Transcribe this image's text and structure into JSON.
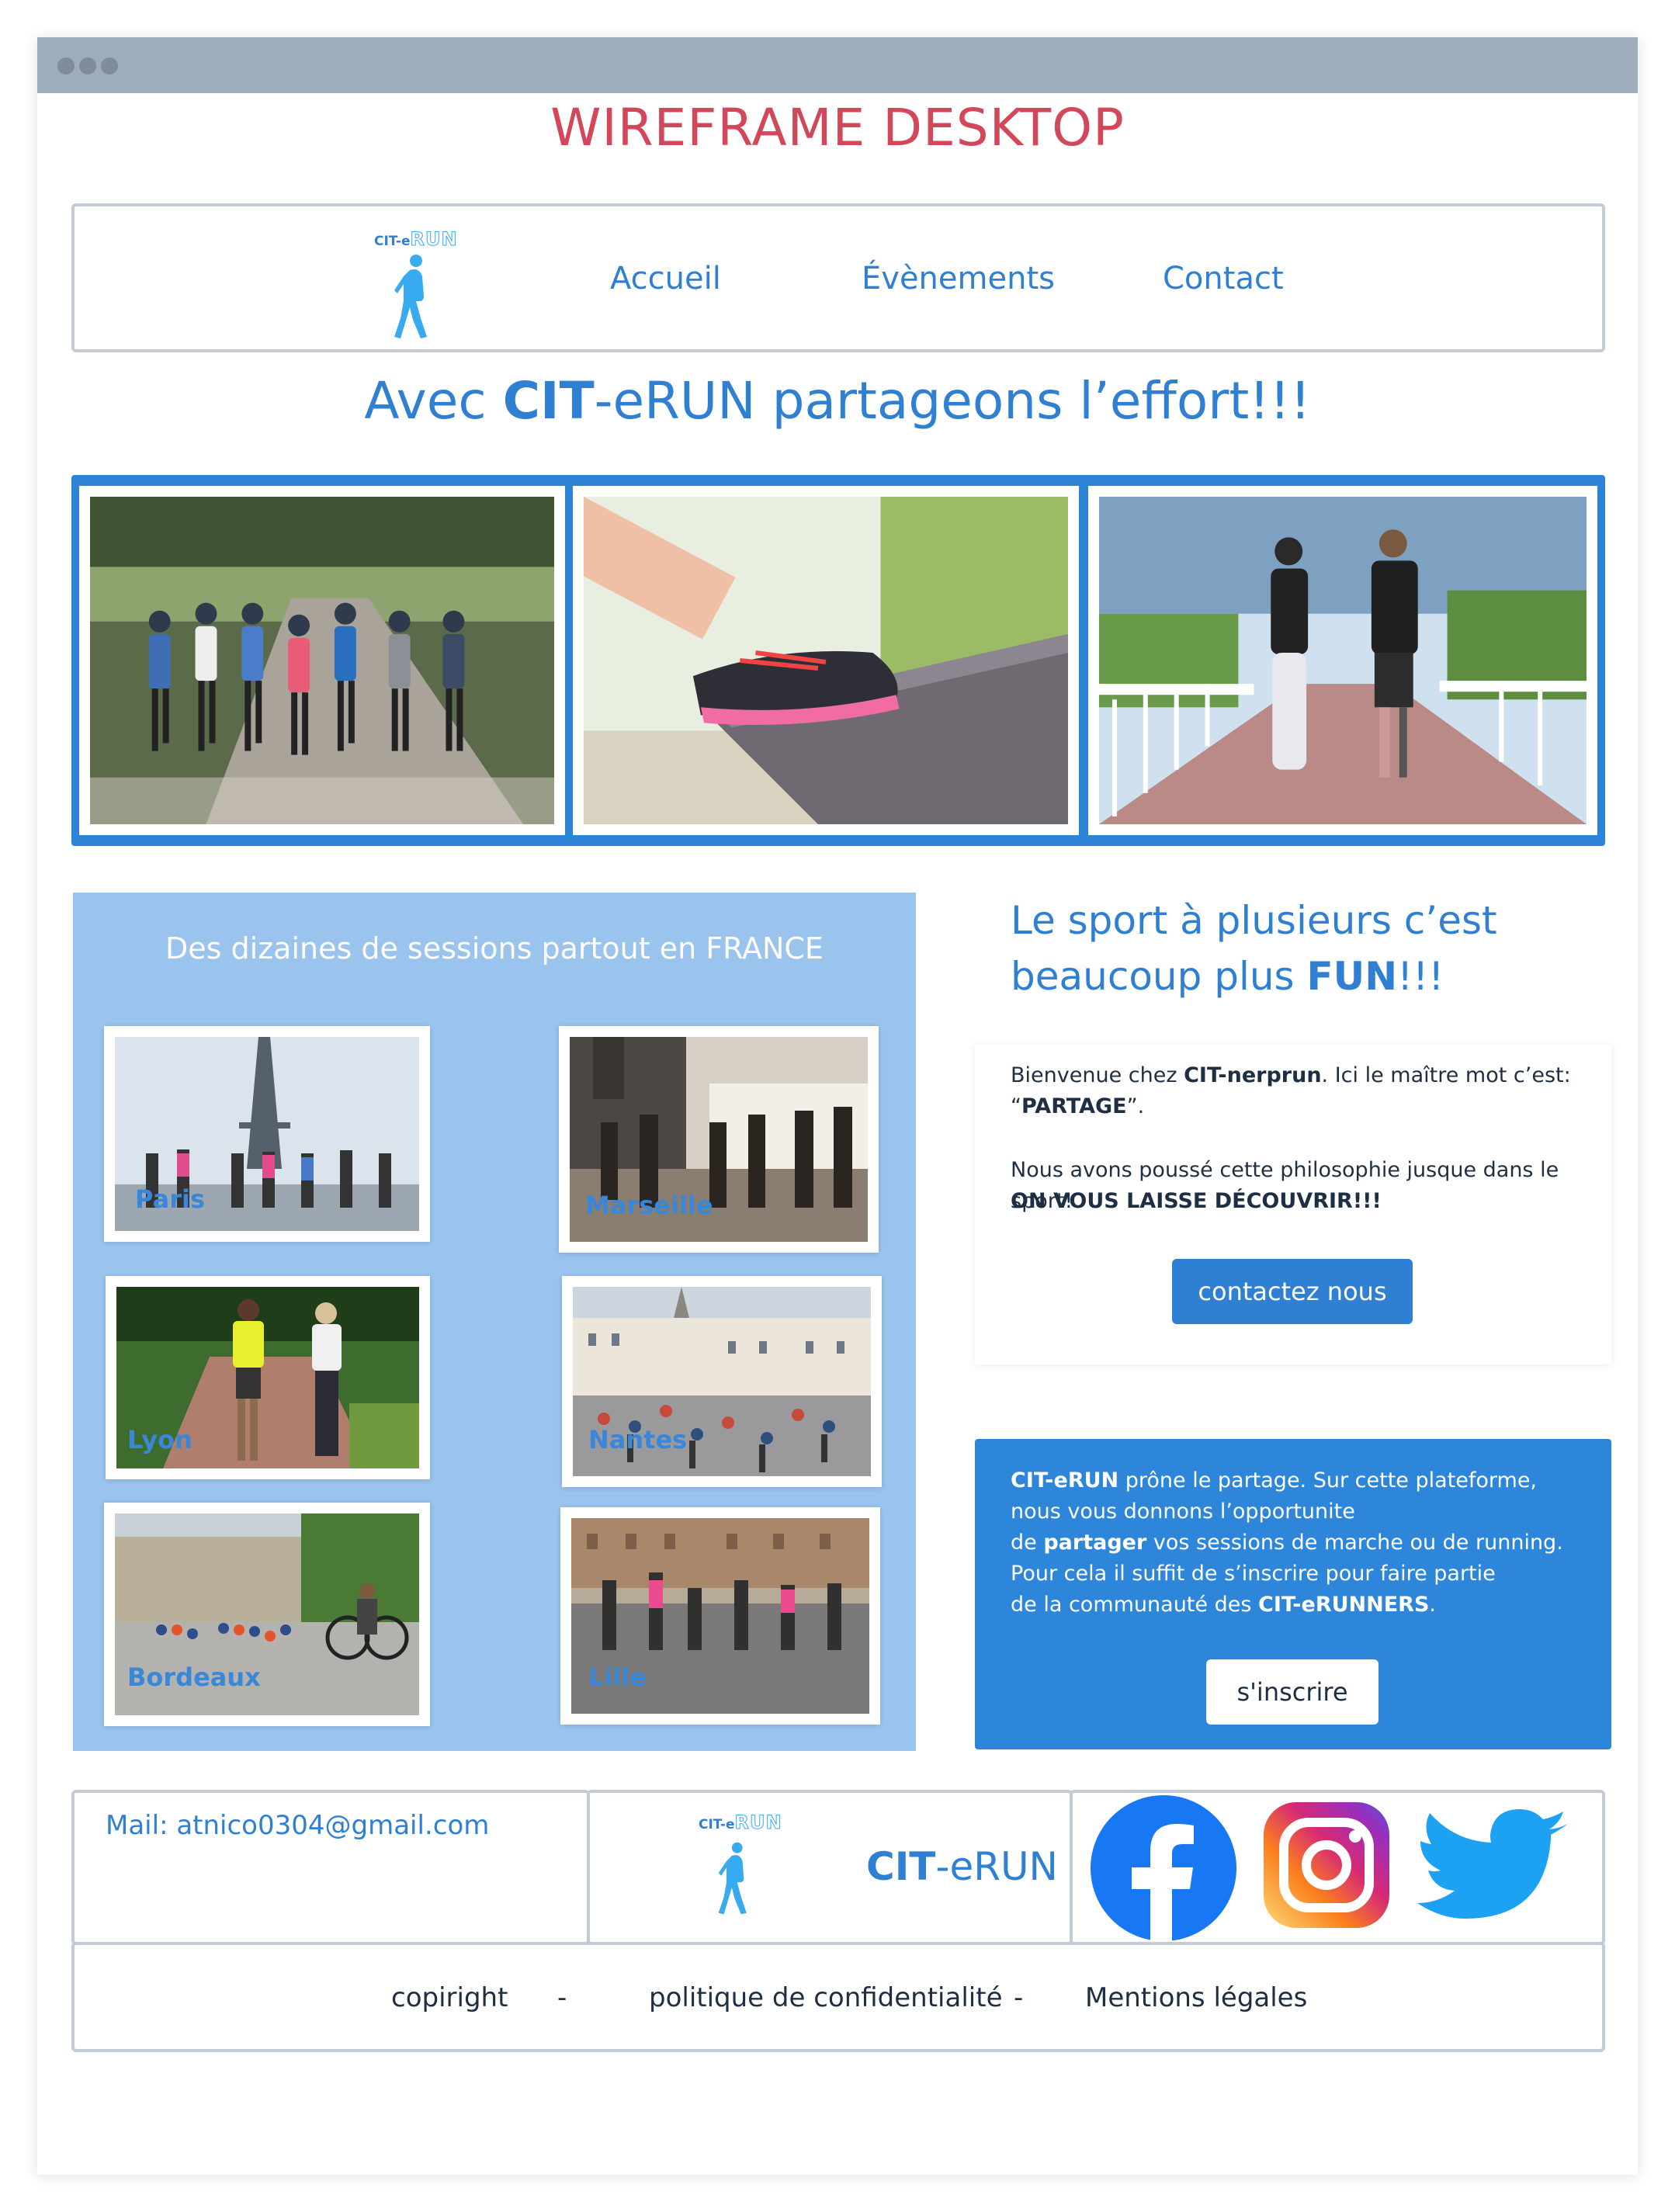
{
  "wireframe_title": "WIREFRAME DESKTOP",
  "logo": {
    "prefix": "CIT-e",
    "suffix": "RUN"
  },
  "nav": {
    "home": "Accueil",
    "events": "Évènements",
    "contact": "Contact"
  },
  "hero": {
    "pre": "Avec ",
    "bold": "CIT",
    "post": "-eRUN partageons l’effort!!!"
  },
  "gallery": {
    "images": [
      "group-runners-photo",
      "shoe-lacing-photo",
      "couple-running-bridge-photo"
    ]
  },
  "cities": {
    "title": "Des dizaines de sessions partout en FRANCE",
    "items": [
      "Paris",
      "Marseille",
      "Lyon",
      "Nantes",
      "Bordeaux",
      "Lille"
    ]
  },
  "side": {
    "title_line1": "Le sport à plusieurs c’est",
    "title_line2_pre": "beaucoup plus ",
    "title_line2_bold": "FUN",
    "title_line2_post": "!!!"
  },
  "welcome": {
    "l1_pre": "Bienvenue chez ",
    "l1_bold": "CIT-nerprun",
    "l1_post": ". Ici le maître mot c’est:",
    "l2_pre": "“",
    "l2_bold": "PARTAGE",
    "l2_post": "”.",
    "l3": "Nous avons poussé cette philosophie jusque dans le sport!",
    "l4": "ON VOUS LAISSE DÉCOUVRIR!!!",
    "button": "contactez nous"
  },
  "join": {
    "l1_bold": "CIT-eRUN",
    "l1_post": " prône le partage. Sur cette plateforme,",
    "l2": "nous vous donnons l’opportunite",
    "l3_pre": "de ",
    "l3_bold": "partager",
    "l3_post": " vos sessions de marche ou de running.",
    "l4": "Pour cela il suffit de s’inscrire pour faire partie",
    "l5_pre": "de la communauté des ",
    "l5_bold": "CIT-eRUNNERS",
    "l5_post": ".",
    "button": "s'inscrire"
  },
  "footer": {
    "mail": "Mail: atnico0304@gmail.com",
    "brand_bold": "CIT",
    "brand_rest": "-eRUN",
    "links": {
      "copyright": "copiright",
      "sep1": "-",
      "privacy": "politique de confidentialité",
      "sep2": "-",
      "legal": "Mentions légales"
    },
    "social": [
      "facebook-icon",
      "instagram-icon",
      "twitter-icon"
    ]
  },
  "colors": {
    "accent": "#2f7fd3",
    "title_red": "#d2485a",
    "panel_light_blue": "#9ac3ed",
    "button_blue": "#2d86da"
  }
}
